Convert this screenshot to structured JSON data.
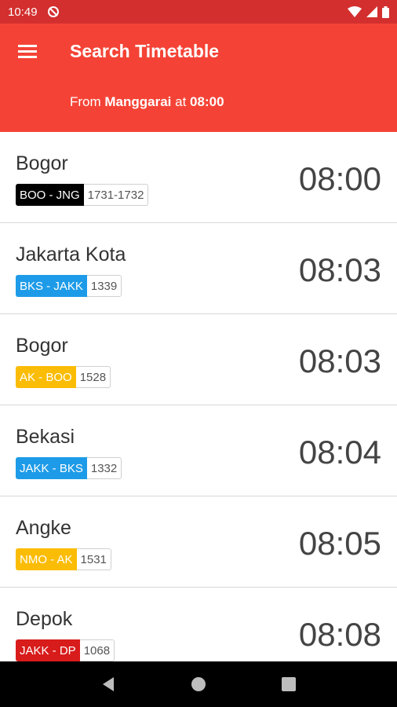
{
  "status_bar": {
    "time": "10:49",
    "icons": [
      "sync-disabled-icon",
      "wifi-icon",
      "signal-icon",
      "battery-icon"
    ]
  },
  "app_bar": {
    "title": "Search Timetable",
    "subtitle_from_prefix": "From ",
    "station": "Manggarai",
    "subtitle_at": " at ",
    "time": "08:00"
  },
  "colors": {
    "status_bar": "#D32F2F",
    "app_bar": "#F44336",
    "black_route": "#000000",
    "blue_route": "#1E9BE8",
    "yellow_route": "#FBBC05",
    "red_route": "#D81B1B"
  },
  "trips": [
    {
      "destination": "Bogor",
      "route": "BOO - JNG",
      "train": "1731-1732",
      "time": "08:00",
      "color": "#000000"
    },
    {
      "destination": "Jakarta Kota",
      "route": "BKS - JAKK",
      "train": "1339",
      "time": "08:03",
      "color": "#1E9BE8"
    },
    {
      "destination": "Bogor",
      "route": "AK - BOO",
      "train": "1528",
      "time": "08:03",
      "color": "#FBBC05"
    },
    {
      "destination": "Bekasi",
      "route": "JAKK - BKS",
      "train": "1332",
      "time": "08:04",
      "color": "#1E9BE8"
    },
    {
      "destination": "Angke",
      "route": "NMO - AK",
      "train": "1531",
      "time": "08:05",
      "color": "#FBBC05"
    },
    {
      "destination": "Depok",
      "route": "JAKK - DP",
      "train": "1068",
      "time": "08:08",
      "color": "#D81B1B"
    }
  ],
  "nav_bar": {
    "buttons": [
      "back-icon",
      "home-icon",
      "recents-icon"
    ]
  }
}
